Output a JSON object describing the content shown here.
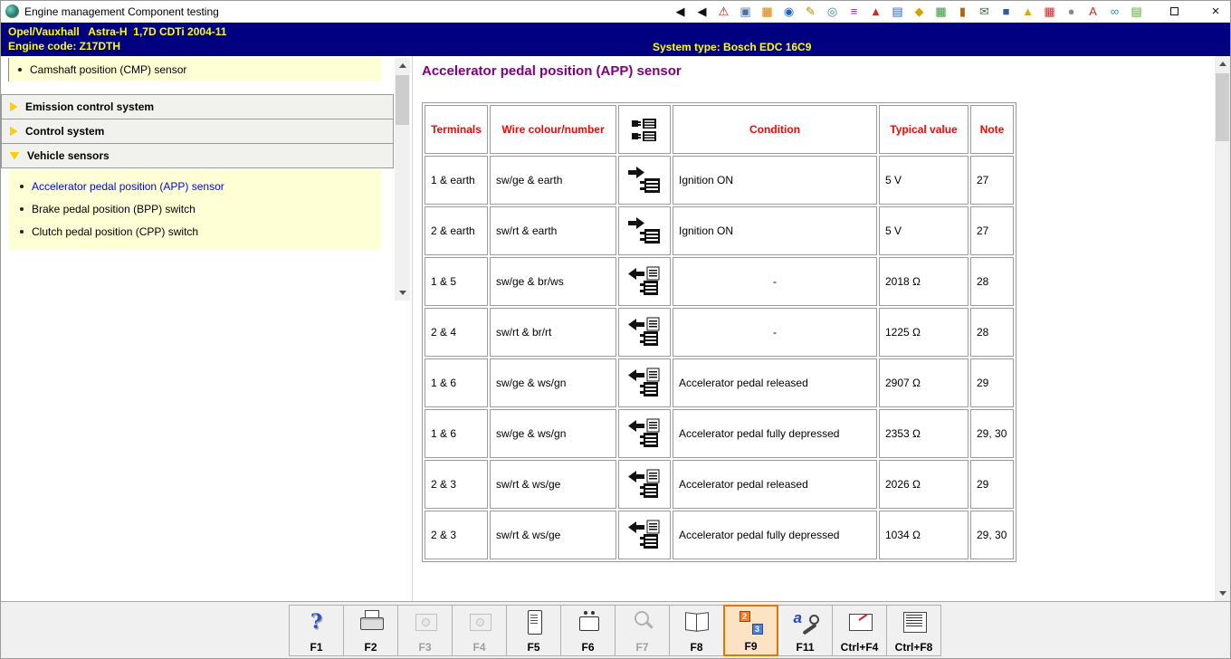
{
  "window": {
    "title": "Engine management Component testing",
    "close_glyph": "×"
  },
  "titlebar_icons": [
    {
      "name": "go-first-icon",
      "glyph": "◀",
      "fg": "#101010"
    },
    {
      "name": "go-back-icon",
      "glyph": "◀",
      "fg": "#101010"
    },
    {
      "name": "warning-icon",
      "glyph": "⚠",
      "fg": "#d40000"
    },
    {
      "name": "monitor-icon",
      "glyph": "▣",
      "fg": "#4a6fa5"
    },
    {
      "name": "module-icon",
      "glyph": "▦",
      "fg": "#d07818"
    },
    {
      "name": "globe-icon",
      "glyph": "◉",
      "fg": "#1b62c4"
    },
    {
      "name": "service-icon",
      "glyph": "✎",
      "fg": "#b8860b"
    },
    {
      "name": "gauge-icon",
      "glyph": "◎",
      "fg": "#2e8b8b"
    },
    {
      "name": "wiring-icon",
      "glyph": "≡",
      "fg": "#7a2ea0"
    },
    {
      "name": "chart-icon",
      "glyph": "▲",
      "fg": "#c23030"
    },
    {
      "name": "manual-book-icon",
      "glyph": "▤",
      "fg": "#2f5fbf"
    },
    {
      "name": "car-data-icon",
      "glyph": "◆",
      "fg": "#d5a000"
    },
    {
      "name": "schedule-icon",
      "glyph": "▦",
      "fg": "#3f8f3f"
    },
    {
      "name": "fuse-icon",
      "glyph": "▮",
      "fg": "#c06000"
    },
    {
      "name": "bulletin-icon",
      "glyph": "✉",
      "fg": "#2e7d32"
    },
    {
      "name": "disk-icon",
      "glyph": "■",
      "fg": "#35589f"
    },
    {
      "name": "spark-icon",
      "glyph": "▲",
      "fg": "#e0a800"
    },
    {
      "name": "report-icon",
      "glyph": "▦",
      "fg": "#c23030"
    },
    {
      "name": "user-icon",
      "glyph": "●",
      "fg": "#8a8a8a"
    },
    {
      "name": "info-icon",
      "glyph": "A",
      "fg": "#c23030"
    },
    {
      "name": "link-icon",
      "glyph": "∞",
      "fg": "#2e8b8b"
    },
    {
      "name": "notes-icon",
      "glyph": "▤",
      "fg": "#5a9f3f"
    }
  ],
  "header": {
    "line1": "Opel/Vauxhall   Astra-H  1,7D CDTi 2004-11",
    "line2": "Engine code: Z17DTH",
    "system_type": "System type: Bosch EDC 16C9"
  },
  "sidebar": {
    "top_item": "Camshaft position (CMP) sensor",
    "sections": [
      {
        "label": "Emission control system",
        "expanded": false
      },
      {
        "label": "Control system",
        "expanded": false
      },
      {
        "label": "Vehicle sensors",
        "expanded": true
      }
    ],
    "items": [
      {
        "label": "Accelerator pedal position (APP) sensor",
        "selected": true
      },
      {
        "label": "Brake pedal position (BPP) switch",
        "selected": false
      },
      {
        "label": "Clutch pedal position (CPP) switch",
        "selected": false
      }
    ]
  },
  "main": {
    "title": "Accelerator pedal position (APP) sensor",
    "table": {
      "headers": {
        "terminals": "Terminals",
        "wire": "Wire colour/number",
        "condition": "Condition",
        "value": "Typical value",
        "note": "Note"
      },
      "rows": [
        {
          "terminals": "1 & earth",
          "wire": "sw/ge & earth",
          "icon": "voltmeter-test-icon",
          "condition": "Ignition ON",
          "center": false,
          "value": "5 V",
          "note": "27"
        },
        {
          "terminals": "2 & earth",
          "wire": "sw/rt & earth",
          "icon": "voltmeter-test-icon",
          "condition": "Ignition ON",
          "center": false,
          "value": "5 V",
          "note": "27"
        },
        {
          "terminals": "1 & 5",
          "wire": "sw/ge & br/ws",
          "icon": "ohmmeter-test-icon",
          "condition": "-",
          "center": true,
          "value": "2018 Ω",
          "note": "28"
        },
        {
          "terminals": "2 & 4",
          "wire": "sw/rt & br/rt",
          "icon": "ohmmeter-test-icon",
          "condition": "-",
          "center": true,
          "value": "1225 Ω",
          "note": "28"
        },
        {
          "terminals": "1 & 6",
          "wire": "sw/ge & ws/gn",
          "icon": "ohmmeter-test-icon",
          "condition": "Accelerator pedal released",
          "center": false,
          "value": "2907 Ω",
          "note": "29"
        },
        {
          "terminals": "1 & 6",
          "wire": "sw/ge & ws/gn",
          "icon": "ohmmeter-test-icon",
          "condition": "Accelerator pedal fully depressed",
          "center": false,
          "value": "2353 Ω",
          "note": "29, 30"
        },
        {
          "terminals": "2 & 3",
          "wire": "sw/rt & ws/ge",
          "icon": "ohmmeter-test-icon",
          "condition": "Accelerator pedal released",
          "center": false,
          "value": "2026 Ω",
          "note": "29"
        },
        {
          "terminals": "2 & 3",
          "wire": "sw/rt & ws/ge",
          "icon": "ohmmeter-test-icon",
          "condition": "Accelerator pedal fully depressed",
          "center": false,
          "value": "1034 Ω",
          "note": "29, 30"
        }
      ]
    }
  },
  "bottom_toolbar": {
    "buttons": [
      {
        "key": "F1",
        "icon": "help-icon",
        "badge1": "?"
      },
      {
        "key": "F2",
        "icon": "printer-icon"
      },
      {
        "key": "F3",
        "icon": "diagram-icon",
        "disabled": true
      },
      {
        "key": "F4",
        "icon": "diagram-plus-icon",
        "disabled": true
      },
      {
        "key": "F5",
        "icon": "control-unit-icon"
      },
      {
        "key": "F6",
        "icon": "connector-pin-icon"
      },
      {
        "key": "F7",
        "icon": "magnifier-icon",
        "disabled": true
      },
      {
        "key": "F8",
        "icon": "manual-icon"
      },
      {
        "key": "F9",
        "icon": "component-test-icon",
        "active": true,
        "badge1": "2",
        "badge2": "3"
      },
      {
        "key": "F11",
        "icon": "adjustments-icon",
        "badge1": "a"
      },
      {
        "key": "Ctrl+F4",
        "icon": "multimeter-icon"
      },
      {
        "key": "Ctrl+F8",
        "icon": "data-list-icon"
      }
    ]
  }
}
